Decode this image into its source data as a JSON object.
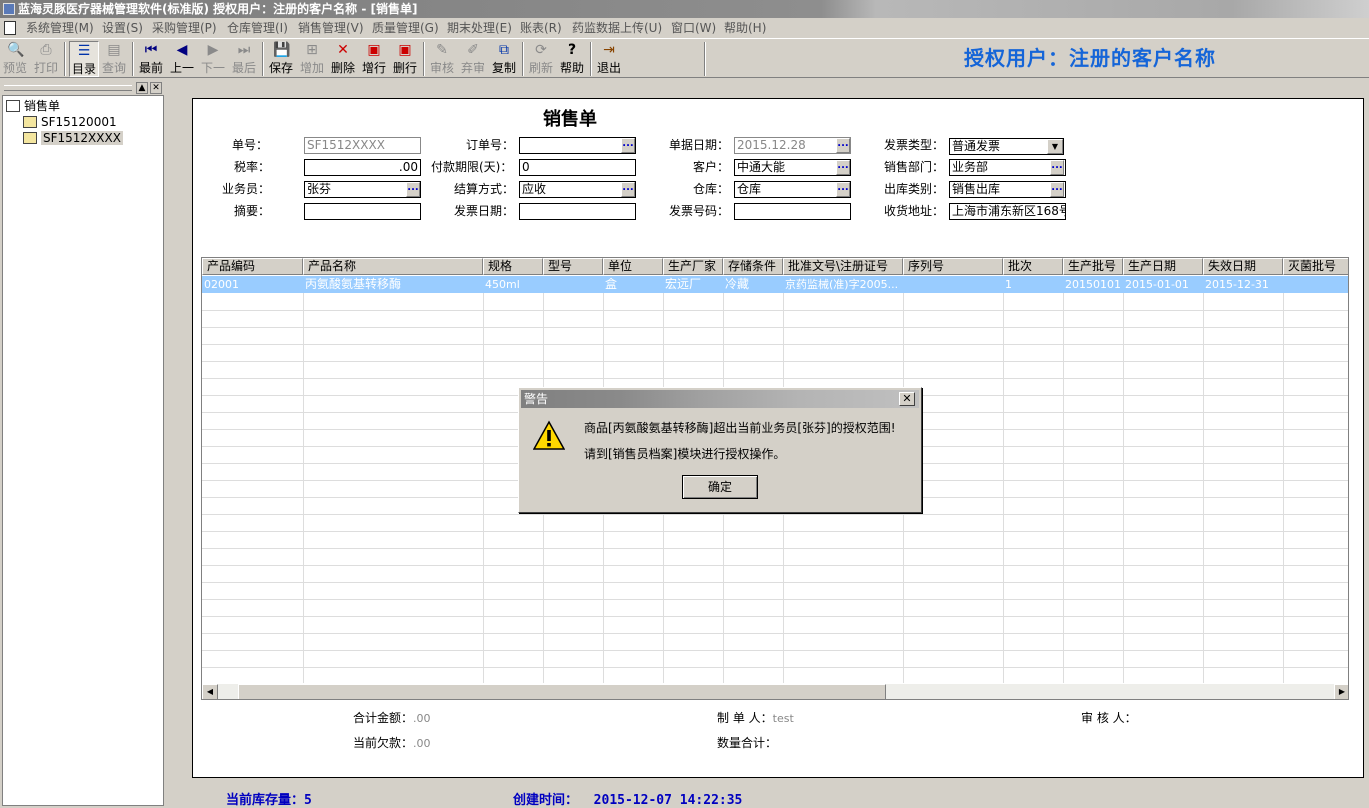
{
  "window": {
    "title": "蓝海灵豚医疗器械管理软件(标准版)   授权用户：注册的客户名称 - [销售单]"
  },
  "menu": [
    "系统管理(M)",
    "设置(S)",
    "采购管理(P)",
    "仓库管理(I)",
    "销售管理(V)",
    "质量管理(G)",
    "期末处理(E)",
    "账表(R)",
    "药监数据上传(U)",
    "窗口(W)",
    "帮助(H)"
  ],
  "toolbar": {
    "buttons": [
      {
        "label": "预览",
        "icon": "preview-icon",
        "enabled": false
      },
      {
        "label": "打印",
        "icon": "print-icon",
        "enabled": false
      },
      {
        "label": "目录",
        "icon": "list-icon",
        "enabled": true,
        "active": true
      },
      {
        "label": "查询",
        "icon": "query-icon",
        "enabled": false
      },
      {
        "label": "最前",
        "icon": "first-icon",
        "enabled": true
      },
      {
        "label": "上一",
        "icon": "prev-icon",
        "enabled": true
      },
      {
        "label": "下一",
        "icon": "next-icon",
        "enabled": false
      },
      {
        "label": "最后",
        "icon": "last-icon",
        "enabled": false
      },
      {
        "label": "保存",
        "icon": "save-icon",
        "enabled": true
      },
      {
        "label": "增加",
        "icon": "add-icon",
        "enabled": false
      },
      {
        "label": "删除",
        "icon": "delete-icon",
        "enabled": true
      },
      {
        "label": "增行",
        "icon": "add-row-icon",
        "enabled": true
      },
      {
        "label": "删行",
        "icon": "delete-row-icon",
        "enabled": true
      },
      {
        "label": "审核",
        "icon": "audit-icon",
        "enabled": false
      },
      {
        "label": "弃审",
        "icon": "unaudit-icon",
        "enabled": false
      },
      {
        "label": "复制",
        "icon": "copy-icon",
        "enabled": true
      },
      {
        "label": "刷新",
        "icon": "refresh-icon",
        "enabled": false
      },
      {
        "label": "帮助",
        "icon": "help-icon",
        "enabled": true
      },
      {
        "label": "退出",
        "icon": "exit-icon",
        "enabled": true
      }
    ],
    "auth_user": "授权用户：注册的客户名称"
  },
  "tree": {
    "root": "销售单",
    "items": [
      "SF15120001",
      "SF1512XXXX"
    ]
  },
  "form": {
    "title": "销售单",
    "labels": {
      "bill_no": "单号：",
      "order_no": "订单号：",
      "bill_date": "单据日期：",
      "invoice_type": "发票类型：",
      "tax_rate": "税率：",
      "pay_days": "付款期限(天)：",
      "customer": "客户：",
      "sales_dept": "销售部门：",
      "salesman": "业务员：",
      "settle": "结算方式：",
      "warehouse": "仓库：",
      "out_type": "出库类别：",
      "summary": "摘要：",
      "invoice_date": "发票日期：",
      "invoice_no": "发票号码：",
      "address": "收货地址："
    },
    "values": {
      "bill_no": "SF1512XXXX",
      "order_no": "",
      "bill_date": "2015.12.28",
      "invoice_type": "普通发票",
      "tax_rate": ".00",
      "pay_days": "0",
      "customer": "中通大能",
      "sales_dept": "业务部",
      "salesman": "张芬",
      "settle": "应收",
      "warehouse": "仓库",
      "out_type": "销售出库",
      "summary": "",
      "invoice_date": "",
      "invoice_no": "",
      "address": "上海市浦东新区168号"
    },
    "dots": "..."
  },
  "grid": {
    "columns": [
      "产品编码",
      "产品名称",
      "规格",
      "型号",
      "单位",
      "生产厂家",
      "存储条件",
      "批准文号\\注册证号",
      "序列号",
      "批次",
      "生产批号",
      "生产日期",
      "失效日期",
      "灭菌批号"
    ],
    "rows": [
      [
        "02001",
        "丙氨酸氨基转移酶",
        "450ml",
        "",
        "盒",
        "宏远厂",
        "冷藏",
        "京药监械(准)字2005...",
        "",
        "1",
        "20150101",
        "2015-01-01",
        "2015-12-31",
        ""
      ]
    ]
  },
  "footer": {
    "total_amount_label": "合计金额：",
    "total_amount": ".00",
    "maker_label": "制 单 人：",
    "maker": "test",
    "auditor_label": "审 核 人：",
    "auditor": "",
    "debt_label": "当前欠款：",
    "debt": ".00",
    "qty_total_label": "数量合计：",
    "qty_total": ""
  },
  "status": {
    "stock_label": "当前库存量：",
    "stock": "5",
    "created_label": "创建时间：",
    "created": "2015-12-07 14:22:35"
  },
  "dialog": {
    "title": "警告",
    "close": "✕",
    "message1": "商品[丙氨酸氨基转移酶]超出当前业务员[张芬]的授权范围!",
    "message2": "请到[销售员档案]模块进行授权操作。",
    "ok": "确定"
  }
}
